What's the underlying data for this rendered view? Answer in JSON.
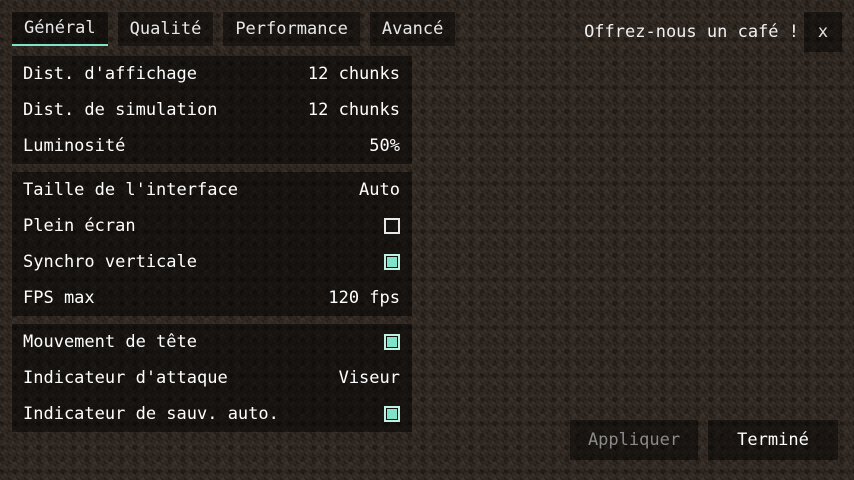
{
  "tabs": [
    {
      "label": "Général",
      "active": true
    },
    {
      "label": "Qualité",
      "active": false
    },
    {
      "label": "Performance",
      "active": false
    },
    {
      "label": "Avancé",
      "active": false
    }
  ],
  "header": {
    "coffee_label": "Offrez-nous un café !",
    "close_label": "x"
  },
  "groups": [
    {
      "rows": [
        {
          "label": "Dist. d'affichage",
          "value": "12 chunks"
        },
        {
          "label": "Dist. de simulation",
          "value": "12 chunks"
        },
        {
          "label": "Luminosité",
          "value": "50%"
        }
      ]
    },
    {
      "rows": [
        {
          "label": "Taille de l'interface",
          "value": "Auto"
        },
        {
          "label": "Plein écran",
          "checked": false
        },
        {
          "label": "Synchro verticale",
          "checked": true
        },
        {
          "label": "FPS max",
          "value": "120 fps"
        }
      ]
    },
    {
      "rows": [
        {
          "label": "Mouvement de tête",
          "checked": true
        },
        {
          "label": "Indicateur d'attaque",
          "value": "Viseur"
        },
        {
          "label": "Indicateur de sauv. auto.",
          "checked": true
        }
      ]
    }
  ],
  "footer": {
    "apply_label": "Appliquer",
    "done_label": "Terminé"
  },
  "colors": {
    "accent": "#7fe3c9",
    "disabled_text": "#8a8a8a"
  }
}
